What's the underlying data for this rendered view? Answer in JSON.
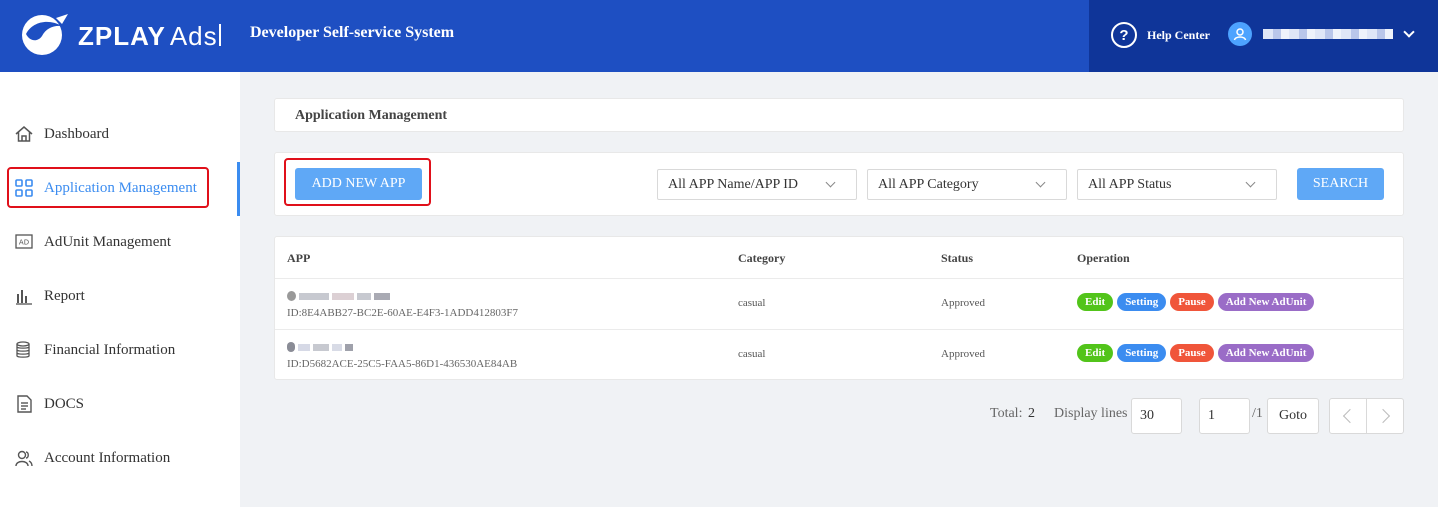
{
  "header": {
    "logo_text": "ZPLAY",
    "logo_suffix": "Ads",
    "system_title": "Developer Self-service System",
    "help_center": "Help Center",
    "help_icon": "question-circle-icon",
    "user_icon": "user-icon"
  },
  "sidebar": {
    "items": [
      {
        "label": "Dashboard",
        "icon": "home-icon"
      },
      {
        "label": "Application Management",
        "icon": "grid-icon"
      },
      {
        "label": "AdUnit Management",
        "icon": "ad-icon"
      },
      {
        "label": "Report",
        "icon": "bar-chart-icon"
      },
      {
        "label": "Financial Information",
        "icon": "coins-icon"
      },
      {
        "label": "DOCS",
        "icon": "document-icon"
      },
      {
        "label": "Account Information",
        "icon": "users-icon"
      }
    ]
  },
  "breadcrumb": {
    "title": "Application Management"
  },
  "toolbar": {
    "add_new_app": "ADD NEW APP",
    "app_filter": "All APP Name/APP ID",
    "category_filter": "All APP Category",
    "status_filter": "All APP Status",
    "search": "SEARCH"
  },
  "table": {
    "headers": {
      "app": "APP",
      "category": "Category",
      "status": "Status",
      "operation": "Operation"
    },
    "rows": [
      {
        "id": "ID:8E4ABB27-BC2E-60AE-E4F3-1ADD412803F7",
        "category": "casual",
        "status": "Approved"
      },
      {
        "id": "ID:D5682ACE-25C5-FAA5-86D1-436530AE84AB",
        "category": "casual",
        "status": "Approved"
      }
    ],
    "ops": {
      "edit": "Edit",
      "setting": "Setting",
      "pause": "Pause",
      "add_adunit": "Add New AdUnit"
    }
  },
  "pagination": {
    "total_label": "Total:",
    "total_value": "2",
    "display_lines_label": "Display lines",
    "display_lines_value": "30",
    "page_value": "1",
    "page_total": "/1",
    "goto": "Goto"
  },
  "colors": {
    "header_bg": "#1e4fc2",
    "accent": "#3b8cf0",
    "edit": "#52c41a",
    "setting": "#3b8cf0",
    "pause": "#f0553a",
    "add_adunit": "#9a6cc7",
    "highlight": "#e0101a"
  }
}
